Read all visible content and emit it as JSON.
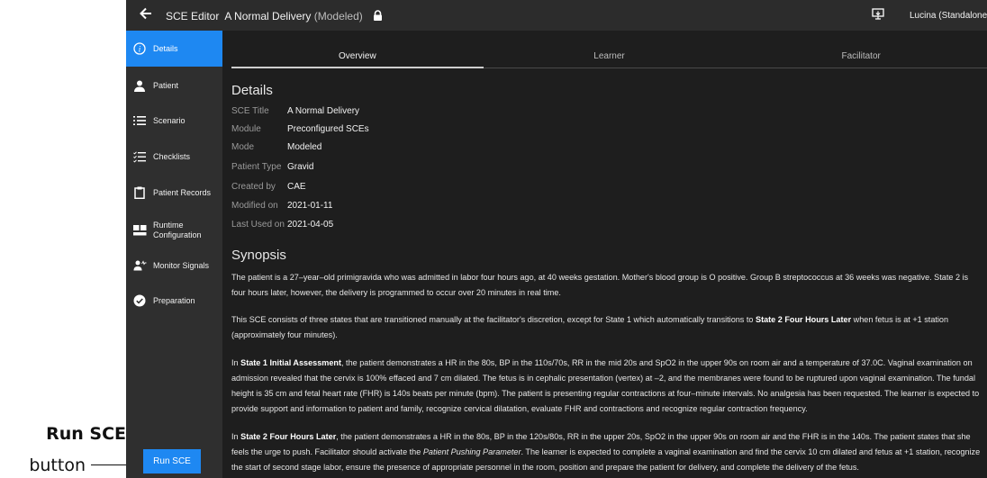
{
  "callout": {
    "title": "Run SCE",
    "subtitle": "button"
  },
  "topbar": {
    "title": "SCE Editor",
    "scenario_name": "A Normal Delivery",
    "mode_suffix": "(Modeled)",
    "user": "Lucina (Standalone"
  },
  "sidebar": {
    "items": [
      {
        "label": "Details",
        "icon": "info-icon"
      },
      {
        "label": "Patient",
        "icon": "person-icon"
      },
      {
        "label": "Scenario",
        "icon": "list-icon"
      },
      {
        "label": "Checklists",
        "icon": "checklist-icon"
      },
      {
        "label": "Patient Records",
        "icon": "clipboard-icon"
      },
      {
        "label": "Runtime Configuration",
        "icon": "runtime-icon"
      },
      {
        "label": "Monitor Signals",
        "icon": "monitor-signals-icon"
      },
      {
        "label": "Preparation",
        "icon": "check-circle-icon"
      }
    ],
    "run_button": "Run SCE"
  },
  "tabs": [
    "Overview",
    "Learner",
    "Facilitator"
  ],
  "details": {
    "heading": "Details",
    "fields": [
      {
        "key": "SCE Title",
        "value": "A Normal Delivery"
      },
      {
        "key": "Module",
        "value": "Preconfigured SCEs"
      },
      {
        "key": "Mode",
        "value": "Modeled"
      },
      {
        "key": "Patient Type",
        "value": "Gravid"
      },
      {
        "key": "Created by",
        "value": "CAE"
      },
      {
        "key": "Modified on",
        "value": "2021-01-11"
      },
      {
        "key": "Last Used on",
        "value": "2021-04-05"
      }
    ]
  },
  "synopsis": {
    "heading": "Synopsis",
    "p1": "The patient is a 27–year–old primigravida who was admitted in labor four hours ago, at 40 weeks gestation. Mother's blood group is O positive. Group B streptococcus at 36 weeks was negative. State 2 is four hours later, however, the delivery is programmed to occur over 20 minutes in real time.",
    "p2_a": "This SCE consists of three states that are transitioned manually at the facilitator's discretion, except for State 1 which automatically transitions to ",
    "p2_b": "State 2 Four Hours Later",
    "p2_c": " when fetus is at +1 station (approximately four minutes).",
    "p3_a": "In ",
    "p3_b": "State 1 Initial Assessment",
    "p3_c": ", the patient demonstrates a HR in the 80s, BP in the 110s/70s, RR in the mid 20s and SpO2 in the upper 90s on room air and a temperature of 37.0C. Vaginal examination on admission revealed that the cervix is 100% effaced and 7 cm dilated. The fetus is in cephalic presentation (vertex) at –2, and the membranes were found to be ruptured upon vaginal examination. The fundal height is 35 cm and fetal heart rate (FHR) is 140s beats per minute (bpm). The patient is presenting regular contractions at four–minute intervals. No analgesia has been requested. The learner is expected to provide support and information to patient and family, recognize cervical dilatation, evaluate FHR and contractions and recognize regular contraction frequency.",
    "p4_a": "In ",
    "p4_b": "State 2 Four Hours Later",
    "p4_c": ", the patient demonstrates a HR in the 80s, BP in the 120s/80s, RR in the upper 20s, SpO2 in the upper 90s on room air and the FHR is in the 140s. The patient states that she feels the urge to push. Facilitator should activate the ",
    "p4_d": "Patient Pushing Parameter",
    "p4_e": ". The learner is expected to complete a vaginal examination and find the cervix 10 cm dilated and fetus at +1 station, recognize the start of second stage labor, ensure the presence of appropriate personnel in the room, position and prepare the patient for delivery, and complete the delivery of the fetus."
  }
}
